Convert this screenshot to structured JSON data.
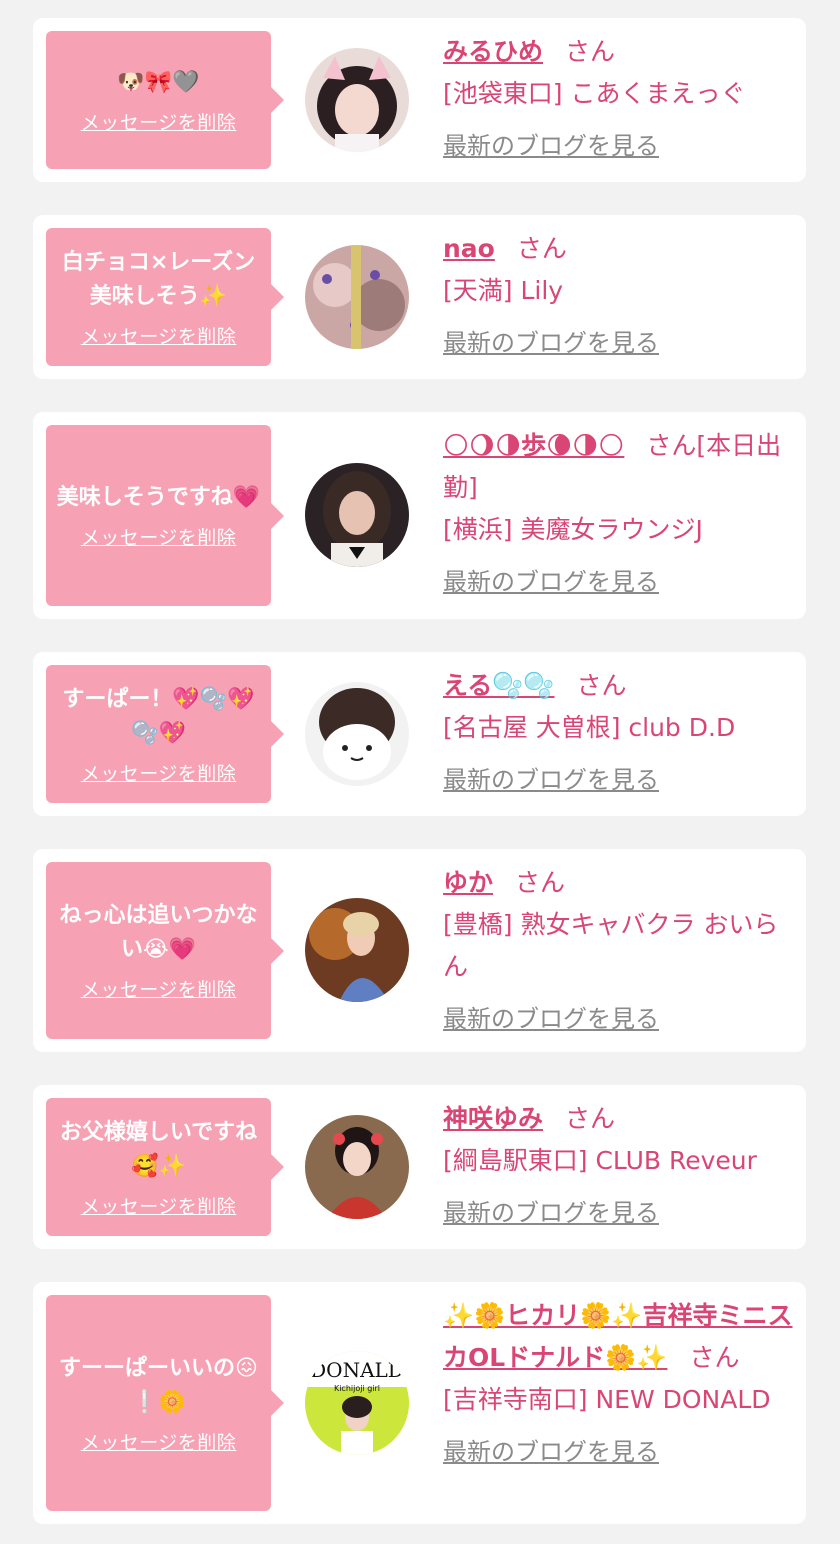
{
  "delete_label": "メッセージを削除",
  "san_label": "さん",
  "blog_label": "最新のブログを見る",
  "colors": {
    "background": "#f2f2f2",
    "card": "#ffffff",
    "bubble": "#f6a2b4",
    "accent": "#d94676",
    "link_gray": "#8a8a8a"
  },
  "items": [
    {
      "message": "🐶🎀🩶",
      "name": "みるひめ",
      "suffix": "",
      "shop": "[池袋東口] こあくまえっぐ",
      "avatar": "avatar-photo-girl-cat-ears"
    },
    {
      "message": "白チョコ×レーズン美味しそう✨",
      "name": "nao",
      "suffix": "",
      "shop": "[天満] Lily",
      "avatar": "avatar-photo-decorated"
    },
    {
      "message": "美味しそうですね💗",
      "name": "🌕🌖🌗歩🌘🌗🌕",
      "suffix": "[本日出勤]",
      "shop": "[横浜] 美魔女ラウンジJ",
      "avatar": "avatar-photo-woman-dark"
    },
    {
      "message": "すーぱー！💖🫧💖🫧💖",
      "name": "える🫧🫧",
      "suffix": "",
      "shop": "[名古屋 大曽根] club D.D",
      "avatar": "avatar-photo-cat-filter"
    },
    {
      "message": "ねっ心は追いつかない😭💗",
      "name": "ゆか",
      "suffix": "",
      "shop": "[豊橋] 熟女キャバクラ おいらん",
      "avatar": "avatar-photo-kimono-fan"
    },
    {
      "message": "お父様嬉しいですね🥰✨",
      "name": "神咲ゆみ",
      "suffix": "",
      "shop": "[綱島駅東口] CLUB Reveur",
      "avatar": "avatar-photo-kimono-red"
    },
    {
      "message": "すーーぱーいいの😖❕🌼",
      "name": "✨🌼ヒカリ🌼✨吉祥寺ミニスカOLドナルド🌼✨",
      "suffix": "",
      "shop": "[吉祥寺南口] NEW DONALD",
      "avatar": "avatar-photo-donald-logo",
      "avatar_text": "DONALD",
      "avatar_subtext": "Kichijoji girl"
    }
  ]
}
